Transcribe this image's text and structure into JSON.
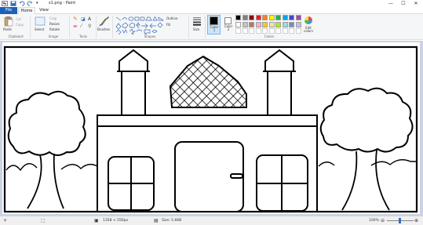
{
  "window": {
    "title": "s1.png - Paint"
  },
  "titlebar": {
    "minimize": "—",
    "maximize": "☐",
    "close": "✕"
  },
  "tabs": {
    "file": "File",
    "home": "Home",
    "view": "View"
  },
  "clipboard": {
    "paste": "Paste",
    "cut": "Cut",
    "copy": "Copy",
    "group": "Clipboard"
  },
  "image": {
    "select": "Select",
    "crop": "Crop",
    "resize": "Resize",
    "rotate": "Rotate",
    "group": "Image"
  },
  "tools": {
    "group": "Tools"
  },
  "brushes": {
    "label": "Brushes"
  },
  "shapes": {
    "outline": "Outline",
    "fill": "Fill",
    "group": "Shapes"
  },
  "size": {
    "label": "Size"
  },
  "colors": {
    "color1_label": "Color 1",
    "color2_label": "Color 2",
    "edit_label": "Edit colors",
    "group": "Colors",
    "color1": "#000000",
    "color2": "#ffffff",
    "palette_row1": [
      "#000000",
      "#7f7f7f",
      "#880015",
      "#ed1c24",
      "#ff7f27",
      "#fff200",
      "#22b14c",
      "#00a2e8",
      "#3f48cc",
      "#a349a4"
    ],
    "palette_row2": [
      "#ffffff",
      "#c3c3c3",
      "#b97a57",
      "#ffaec9",
      "#ffc90e",
      "#efe4b0",
      "#b5e61d",
      "#99d9ea",
      "#7092be",
      "#c8bfe7"
    ]
  },
  "status": {
    "dimensions": "1358 × 550px",
    "size": "Size: 5.6KB",
    "zoom": "100%"
  }
}
